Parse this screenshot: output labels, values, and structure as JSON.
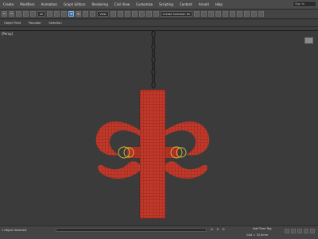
{
  "menubar": {
    "items": [
      "Create",
      "Modifiers",
      "Animation",
      "Graph Editors",
      "Rendering",
      "Civil View",
      "Customize",
      "Scripting",
      "Content",
      "Arnold",
      "Help"
    ],
    "search_placeholder": "Sign In"
  },
  "toolbar": {
    "selection_filter": "All",
    "view_dropdown": "View",
    "selection_set": "Create Selection Se"
  },
  "ribbon": {
    "tabs": [
      "Object Paint",
      "Populate",
      "Selection"
    ]
  },
  "viewport": {
    "label": "[Persp]",
    "mesh_color": "#c0392b",
    "wire_color": "#7a1d12",
    "gizmo_color": "#d9c23a"
  },
  "status": {
    "selection_text": "1 Object Selected",
    "coord_x": "X:",
    "coord_y": "Y:",
    "coord_z": "Z:",
    "grid": "Grid = 10,0mm",
    "add_time_tag": "Add Time Tag"
  }
}
